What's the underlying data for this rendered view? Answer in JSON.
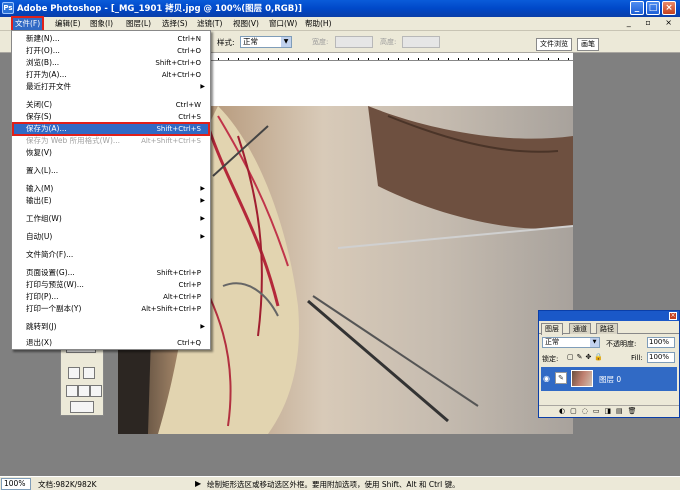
{
  "window": {
    "title": "Adobe Photoshop - [_MG_1901 拷贝.jpg @ 100%(图层 0,RGB)]",
    "minimize": "_",
    "maximize": "□",
    "close": "×"
  },
  "menubar": {
    "items": [
      "文件(F)",
      "编辑(E)",
      "图象(I)",
      "图层(L)",
      "选择(S)",
      "滤镜(T)",
      "视图(V)",
      "窗口(W)",
      "帮助(H)"
    ],
    "mdi_controls": "_ ▫ ×"
  },
  "options_bar": {
    "style_label": "样式:",
    "style_value": "正常",
    "width_label": "宽度:",
    "height_label": "高度:",
    "palette_tabs": [
      "文件浏览",
      "画笔"
    ]
  },
  "file_menu": {
    "items": [
      {
        "label": "新建(N)...",
        "shortcut": "Ctrl+N"
      },
      {
        "label": "打开(O)...",
        "shortcut": "Ctrl+O"
      },
      {
        "label": "浏览(B)...",
        "shortcut": "Shift+Ctrl+O"
      },
      {
        "label": "打开为(A)...",
        "shortcut": "Alt+Ctrl+O"
      },
      {
        "label": "最近打开文件",
        "shortcut": ""
      },
      {
        "label": "关闭(C)",
        "shortcut": "Ctrl+W"
      },
      {
        "label": "保存(S)",
        "shortcut": "Ctrl+S"
      },
      {
        "label": "保存为(A)...",
        "shortcut": "Shift+Ctrl+S"
      },
      {
        "label": "保存为 Web 所用格式(W)...",
        "shortcut": "Alt+Shift+Ctrl+S"
      },
      {
        "label": "恢复(V)",
        "shortcut": ""
      },
      {
        "label": "置入(L)...",
        "shortcut": ""
      },
      {
        "label": "输入(M)",
        "shortcut": ""
      },
      {
        "label": "输出(E)",
        "shortcut": ""
      },
      {
        "label": "工作组(W)",
        "shortcut": ""
      },
      {
        "label": "自动(U)",
        "shortcut": ""
      },
      {
        "label": "文件简介(F)...",
        "shortcut": ""
      },
      {
        "label": "页面设置(G)...",
        "shortcut": "Shift+Ctrl+P"
      },
      {
        "label": "打印与预览(W)...",
        "shortcut": "Ctrl+P"
      },
      {
        "label": "打印(P)...",
        "shortcut": "Alt+Ctrl+P"
      },
      {
        "label": "打印一个副本(Y)",
        "shortcut": "Alt+Shift+Ctrl+P"
      },
      {
        "label": "跳转到(J)",
        "shortcut": ""
      },
      {
        "label": "退出(X)",
        "shortcut": "Ctrl+Q"
      }
    ],
    "submenu_arrow": "▶"
  },
  "layers_panel": {
    "tabs": [
      "图层",
      "通道",
      "路径"
    ],
    "blend_mode": "正常",
    "opacity_label": "不透明度:",
    "opacity_value": "100%",
    "lock_label": "锁定:",
    "fill_label": "Fill:",
    "fill_value": "100%",
    "layer_name": "图层 0"
  },
  "status_bar": {
    "zoom": "100%",
    "doc_info": "文档:982K/982K",
    "hint": "绘制矩形选区或移动选区外框。要用附加选项，使用 Shift、Alt 和 Ctrl 键。"
  }
}
